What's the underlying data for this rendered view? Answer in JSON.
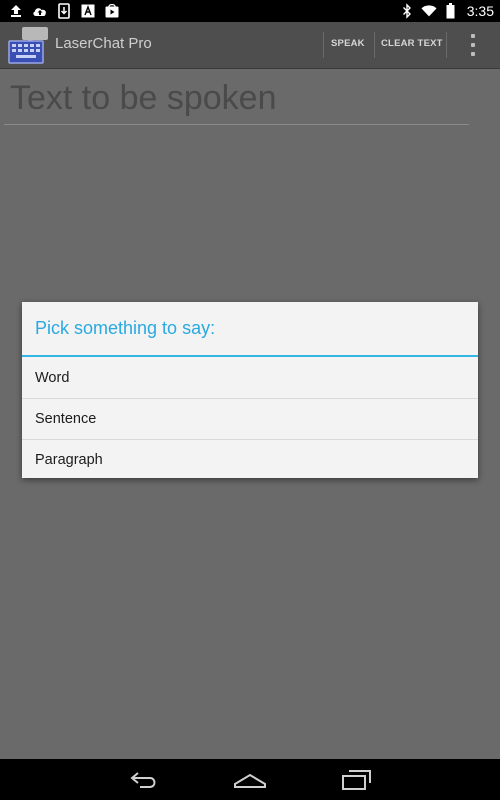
{
  "status_bar": {
    "time": "3:35",
    "left_icons": [
      "upload-icon",
      "cloud-upload-icon",
      "download-to-device-icon",
      "font-icon",
      "play-store-icon"
    ],
    "right_icons": [
      "bluetooth-icon",
      "wifi-icon",
      "battery-icon"
    ]
  },
  "action_bar": {
    "app_title": "LaserChat Pro",
    "speak_label": "SPEAK",
    "clear_label": "CLEAR TEXT"
  },
  "main": {
    "text_field": {
      "placeholder": "Text to be spoken",
      "value": ""
    }
  },
  "dialog": {
    "title": "Pick something to say:",
    "items": [
      {
        "label": "Word"
      },
      {
        "label": "Sentence"
      },
      {
        "label": "Paragraph"
      }
    ]
  },
  "nav_bar": {
    "buttons": [
      "back-icon",
      "home-icon",
      "recent-apps-icon"
    ]
  },
  "colors": {
    "accent": "#33b5e5",
    "dim_background": "#6a6a6a",
    "action_bar": "#4e4e4e"
  }
}
